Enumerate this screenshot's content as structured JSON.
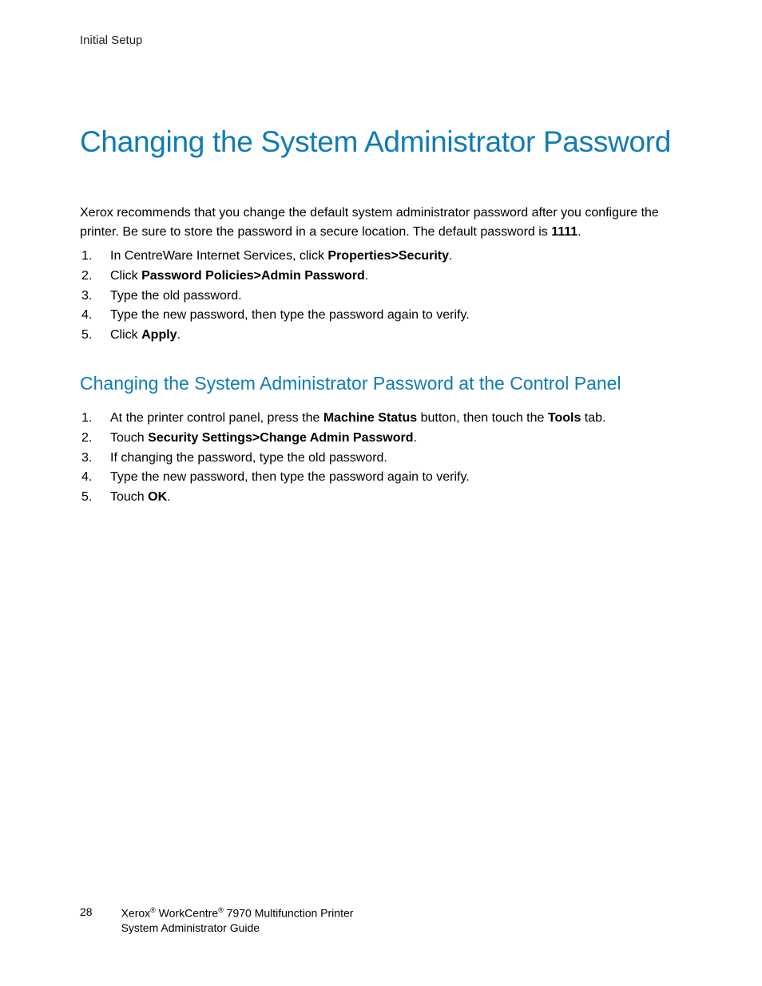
{
  "header": {
    "section": "Initial Setup"
  },
  "title": "Changing the System Administrator Password",
  "intro": {
    "pre": "Xerox recommends that you change the default system administrator password after you configure the printer. Be sure to store the password in a secure location. The default password is ",
    "bold": "1111",
    "post": "."
  },
  "steps1": {
    "s1_pre": "In CentreWare Internet Services, click ",
    "s1_b1": "Properties",
    "s1_gt1": ">",
    "s1_b2": "Security",
    "s1_post": ".",
    "s2_pre": "Click ",
    "s2_b1": "Password Policies",
    "s2_gt1": ">",
    "s2_b2": "Admin Password",
    "s2_post": ".",
    "s3": "Type the old password.",
    "s4": "Type the new password, then type the password again to verify.",
    "s5_pre": "Click ",
    "s5_b": "Apply",
    "s5_post": "."
  },
  "subheading": "Changing the System Administrator Password at the Control Panel",
  "steps2": {
    "s1_pre": "At the printer control panel, press the ",
    "s1_b1": "Machine Status",
    "s1_mid": " button, then touch the ",
    "s1_b2": "Tools",
    "s1_post": " tab.",
    "s2_pre": "Touch ",
    "s2_b1": "Security Settings",
    "s2_gt1": ">",
    "s2_b2": "Change Admin Password",
    "s2_post": ".",
    "s3": "If changing the password, type the old password.",
    "s4": "Type the new password, then type the password again to verify.",
    "s5_pre": "Touch ",
    "s5_b": "OK",
    "s5_post": "."
  },
  "footer": {
    "pagenum": "28",
    "line1_a": "Xerox",
    "line1_b": " WorkCentre",
    "line1_c": " 7970 Multifunction Printer",
    "line2": "System Administrator Guide",
    "reg": "®"
  }
}
